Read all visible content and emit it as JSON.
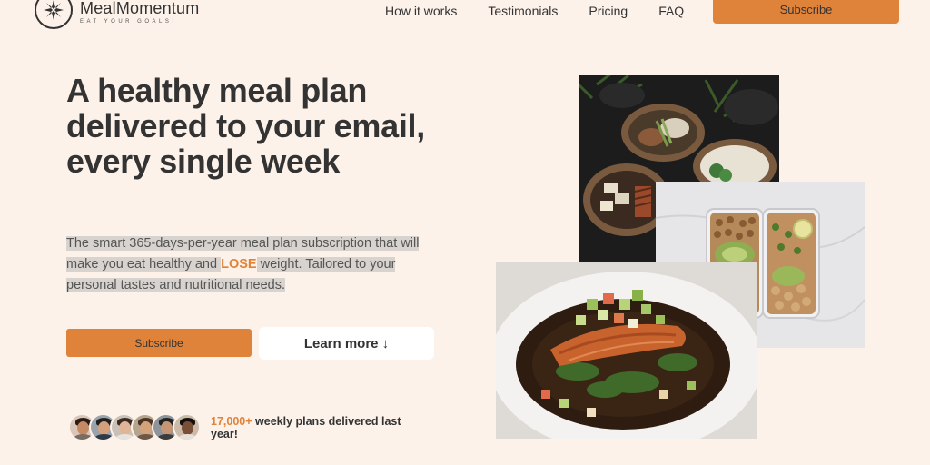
{
  "brand": {
    "name": "MealMomentum",
    "tagline": "EAT YOUR GOALS!"
  },
  "nav": {
    "items": [
      "How it works",
      "Testimonials",
      "Pricing",
      "FAQ"
    ],
    "subscribe_label": "Subscribe"
  },
  "hero": {
    "title": "A healthy meal plan delivered to your email, every single week",
    "desc_part1": "The smart 365-days-per-year meal plan subscription that will make you eat healthy and ",
    "desc_emph": "LOSE",
    "desc_part2": " weight. Tailored to your personal tastes and nutritional needs.",
    "subscribe_label": "Subscribe",
    "learn_more_label": "Learn more ↓"
  },
  "social_proof": {
    "count": "17,000+",
    "text": " weekly plans delivered last year!",
    "avatar_icons": [
      "avatar-icon",
      "avatar-icon",
      "avatar-icon",
      "avatar-icon",
      "avatar-icon",
      "avatar-icon"
    ]
  },
  "colors": {
    "accent": "#e0833a",
    "background": "#fcf2ea",
    "text": "#333333"
  }
}
